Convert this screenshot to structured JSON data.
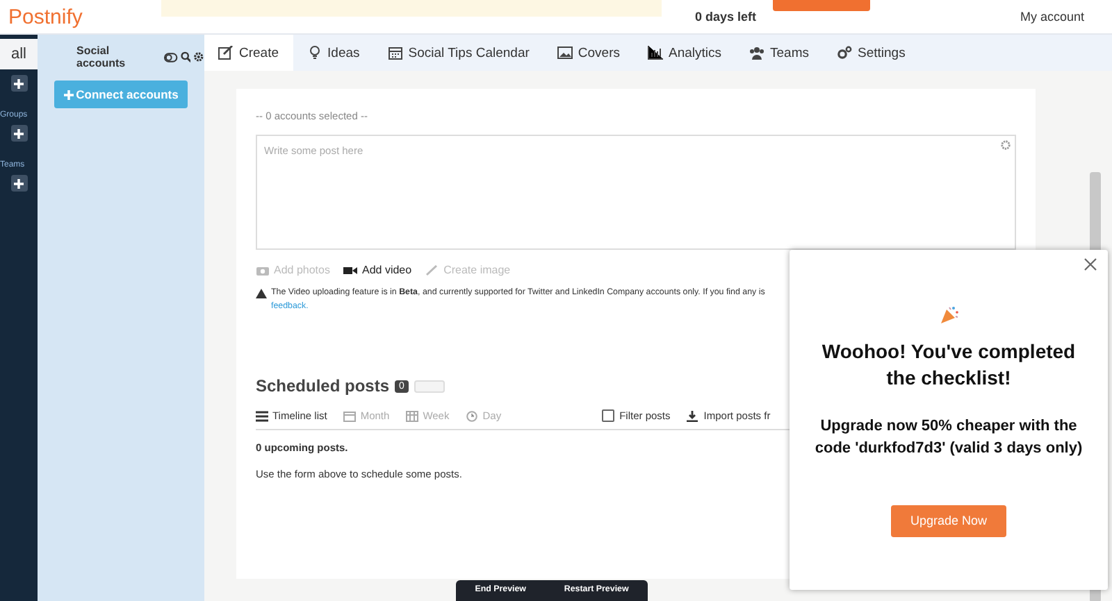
{
  "header": {
    "logo": "Postnify",
    "trial": "0 days left",
    "account": "My account"
  },
  "rail": {
    "tab": "all",
    "sections": [
      "Groups",
      "Teams"
    ]
  },
  "accounts_panel": {
    "title": "Social accounts",
    "button": "Connect accounts"
  },
  "tabs": [
    {
      "label": "Create",
      "selected": true
    },
    {
      "label": "Ideas",
      "selected": false
    },
    {
      "label": "Social Tips Calendar",
      "selected": false
    },
    {
      "label": "Covers",
      "selected": false
    },
    {
      "label": "Analytics",
      "selected": false
    },
    {
      "label": "Teams",
      "selected": false
    },
    {
      "label": "Settings",
      "selected": false
    }
  ],
  "composer": {
    "accounts_selected": "-- 0 accounts selected --",
    "placeholder": "Write some post here",
    "media": [
      {
        "label": "Add photos",
        "disabled": true
      },
      {
        "label": "Add video",
        "disabled": false
      },
      {
        "label": "Create image",
        "disabled": true
      }
    ],
    "notice": "The Video uploading feature is in **Beta**, and currently supported for Twitter and LinkedIn Company accounts only. If you find any is",
    "notice_link": "feedback."
  },
  "scheduled": {
    "title": "Scheduled posts",
    "count": "0",
    "views": [
      {
        "label": "Timeline list",
        "selected": true
      },
      {
        "label": "Month",
        "selected": false
      },
      {
        "label": "Week",
        "selected": false
      },
      {
        "label": "Day",
        "selected": false
      }
    ],
    "filter": {
      "label": "Filter posts",
      "checked": false
    },
    "import": "Import posts fr",
    "upcoming": "0 upcoming posts.",
    "hint": "Use the form above to schedule some posts."
  },
  "popup": {
    "title": "Woohoo! You've completed the checklist!",
    "body": "Upgrade now 50% cheaper with the code 'durkfod7d3' (valid 3 days only)",
    "button": "Upgrade Now"
  },
  "preview_bar": [
    "End Preview",
    "Restart Preview"
  ]
}
